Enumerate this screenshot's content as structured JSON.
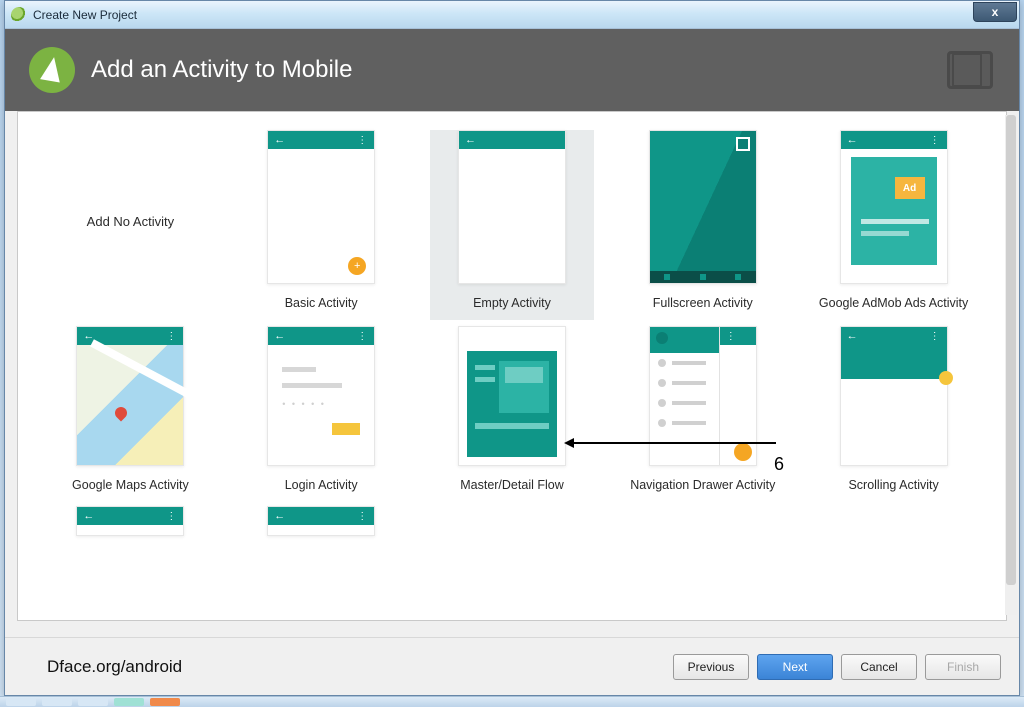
{
  "window": {
    "title": "Create New Project",
    "close_glyph": "x"
  },
  "header": {
    "title": "Add an Activity to Mobile"
  },
  "activities": {
    "row1": [
      {
        "label": "Add No Activity"
      },
      {
        "label": "Basic Activity"
      },
      {
        "label": "Empty Activity",
        "selected": true
      },
      {
        "label": "Fullscreen Activity"
      },
      {
        "label": "Google AdMob Ads Activity"
      }
    ],
    "row2": [
      {
        "label": "Google Maps Activity"
      },
      {
        "label": "Login Activity"
      },
      {
        "label": "Master/Detail Flow"
      },
      {
        "label": "Navigation Drawer Activity"
      },
      {
        "label": "Scrolling Activity"
      }
    ]
  },
  "admob": {
    "ad_text": "Ad"
  },
  "annotation": {
    "number": "6"
  },
  "footer": {
    "watermark": "Dface.org/android",
    "previous": "Previous",
    "next": "Next",
    "cancel": "Cancel",
    "finish": "Finish"
  }
}
